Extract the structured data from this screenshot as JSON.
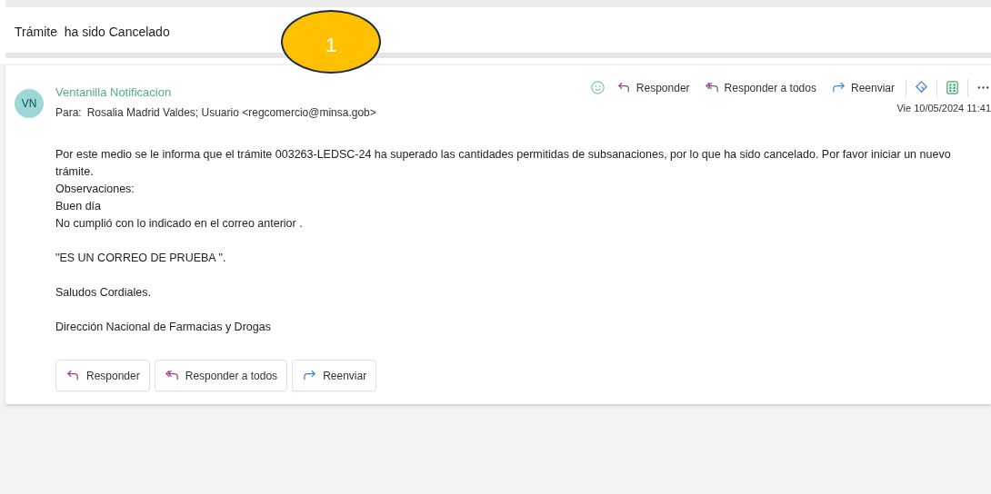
{
  "subject": "Trámite  ha sido Cancelado",
  "callout": {
    "label": "1"
  },
  "message": {
    "avatar": "VN",
    "sender": "Ventanilla Notificacion",
    "to_label": "Para:",
    "recipients": "Rosalia Madrid Valdes;  Usuario <regcomercio@minsa.gob>",
    "date": "Vie 10/05/2024 11:41",
    "actions": [
      {
        "kind": "reply",
        "label": "Responder"
      },
      {
        "kind": "reply_all",
        "label": "Responder a todos"
      },
      {
        "kind": "forward",
        "label": "Reenviar"
      }
    ],
    "body": [
      [
        "Por este medio se le informa que el trámite 003263-LEDSC-24 ha superado las cantidades permitidas de subsanaciones, por lo que ha sido cancelado. Por favor iniciar un nuevo trámite.",
        "Observaciones:",
        "Buen día",
        "No cumplió con lo indicado en el correo anterior ."
      ],
      [
        "\"ES UN CORREO DE PRUEBA \"."
      ],
      [
        "Saludos Cordiales."
      ],
      [
        "Dirección Nacional de Farmacias y Drogas"
      ]
    ],
    "footer_actions": [
      {
        "kind": "reply",
        "label": "Responder"
      },
      {
        "kind": "reply_all",
        "label": "Responder a todos"
      },
      {
        "kind": "forward",
        "label": "Reenviar"
      }
    ]
  }
}
